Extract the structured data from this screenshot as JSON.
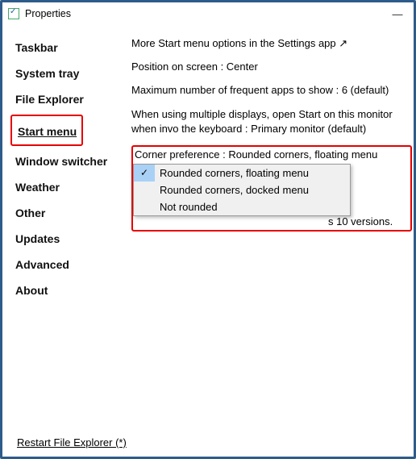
{
  "window": {
    "title": "Properties",
    "minimize": "—"
  },
  "sidebar": {
    "items": [
      {
        "label": "Taskbar"
      },
      {
        "label": "System tray"
      },
      {
        "label": "File Explorer"
      },
      {
        "label": "Start menu",
        "selected": true,
        "highlighted": true
      },
      {
        "label": "Window switcher"
      },
      {
        "label": "Weather"
      },
      {
        "label": "Other"
      },
      {
        "label": "Updates"
      },
      {
        "label": "Advanced"
      },
      {
        "label": "About"
      }
    ]
  },
  "main": {
    "options": [
      "More Start menu options in the Settings app",
      "Position on screen : Center",
      "Maximum number of frequent apps to show : 6 (default)",
      "When using multiple displays, open Start on this monitor when invo the keyboard : Primary monitor (default)"
    ],
    "external_arrow": "↗",
    "corner_label": "Corner preference : Rounded corners, floating menu",
    "dropdown": {
      "items": [
        {
          "label": "Rounded corners, floating menu",
          "selected": true
        },
        {
          "label": "Rounded corners, docked menu",
          "selected": false
        },
        {
          "label": "Not rounded",
          "selected": false
        }
      ]
    },
    "hidden_line_tail": "s 10 versions.",
    "hidden_line_full": "Some settings might not be available in older Windows 10 versions."
  },
  "footer": {
    "restart": "Restart File Explorer (*)"
  }
}
